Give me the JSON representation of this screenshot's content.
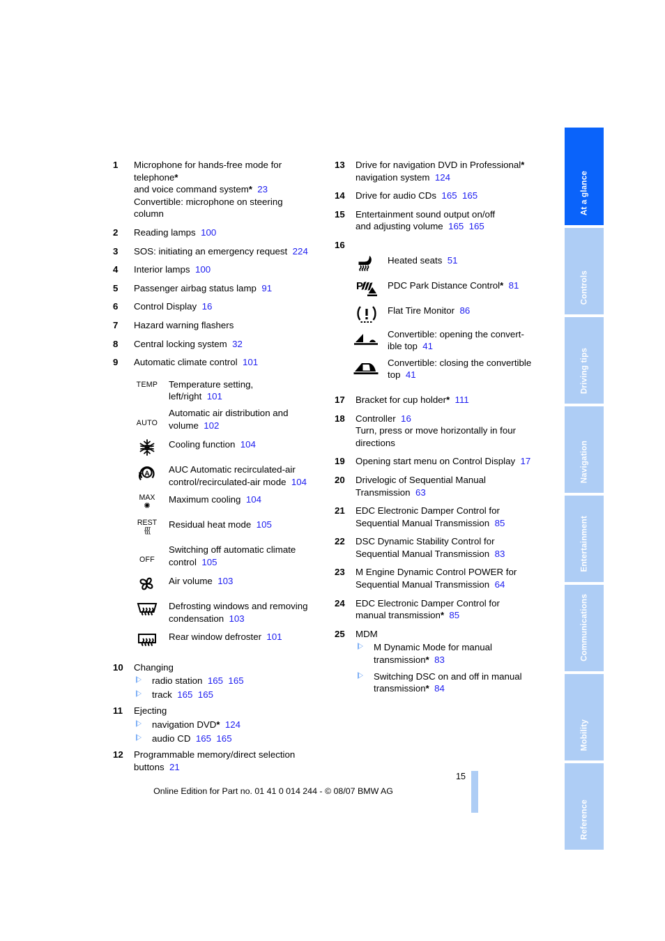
{
  "page": {
    "number": "15",
    "footer": "Online Edition for Part no. 01 41 0 014 244 - © 08/07 BMW AG",
    "link_color": "#1c1cf0",
    "tab_active_color": "#0a63fa",
    "tab_inactive_color": "#aecdf5"
  },
  "tabs": [
    {
      "label": "At a glance",
      "active": true
    },
    {
      "label": "Controls",
      "active": false
    },
    {
      "label": "Driving tips",
      "active": false
    },
    {
      "label": "Navigation",
      "active": false
    },
    {
      "label": "Entertainment",
      "active": false
    },
    {
      "label": "Communications",
      "active": false
    },
    {
      "label": "Mobility",
      "active": false
    },
    {
      "label": "Reference",
      "active": false
    }
  ],
  "left_column": {
    "items": {
      "i1": {
        "num": "1",
        "line1": "Microphone for hands-free mode for",
        "line2": "telephone",
        "line3": "and voice command system",
        "page3": "23",
        "line4": "Convertible: microphone on steering",
        "line5": "column"
      },
      "i2": {
        "num": "2",
        "text": "Reading lamps",
        "page": "100"
      },
      "i3": {
        "num": "3",
        "text": "SOS: initiating an emergency request",
        "page": "224"
      },
      "i4": {
        "num": "4",
        "text": "Interior lamps",
        "page": "100"
      },
      "i5": {
        "num": "5",
        "text": "Passenger airbag status lamp",
        "page": "91"
      },
      "i6": {
        "num": "6",
        "text": "Control Display",
        "page": "16"
      },
      "i7": {
        "num": "7",
        "text": "Hazard warning flashers",
        "page": ""
      },
      "i8": {
        "num": "8",
        "text": "Central locking system",
        "page": "32"
      },
      "i9": {
        "num": "9",
        "text": "Automatic climate control",
        "page": "101"
      },
      "i10": {
        "num": "10",
        "text": "Changing"
      },
      "i11": {
        "num": "11",
        "text": "Ejecting"
      },
      "i12": {
        "num": "12",
        "line1": "Programmable memory/direct selection",
        "line2": "buttons",
        "page": "21"
      }
    },
    "climate_icons": [
      {
        "icon": "TEMP",
        "icon_name": "temp-label-icon",
        "line1": "Temperature setting,",
        "line2": "left/right",
        "page": "101"
      },
      {
        "icon": "AUTO",
        "icon_name": "auto-label-icon",
        "line1": "Automatic air distribution and",
        "line2": "volume",
        "page": "102"
      },
      {
        "icon": "snowflake",
        "icon_name": "snowflake-icon",
        "line1": "Cooling function",
        "line2": "",
        "page": "104"
      },
      {
        "icon": "auc",
        "icon_name": "auc-recirculation-icon",
        "line1": "AUC Automatic recirculated-air",
        "line2": "control/recirculated-air mode",
        "page": "104"
      },
      {
        "icon": "MAX",
        "icon_name": "max-cooling-icon",
        "line1": "Maximum cooling",
        "line2": "",
        "page": "104"
      },
      {
        "icon": "REST",
        "icon_name": "residual-heat-icon",
        "line1": "Residual heat mode",
        "line2": "",
        "page": "105"
      },
      {
        "icon": "OFF",
        "icon_name": "off-label-icon",
        "line1": "Switching off automatic climate",
        "line2": "control",
        "page": "105"
      },
      {
        "icon": "fan",
        "icon_name": "fan-icon",
        "line1": "Air volume",
        "line2": "",
        "page": "103"
      },
      {
        "icon": "defrost-front",
        "icon_name": "windshield-defrost-icon",
        "line1": "Defrosting windows and removing",
        "line2": "condensation",
        "page": "103"
      },
      {
        "icon": "defrost-rear",
        "icon_name": "rear-window-defrost-icon",
        "line1": "Rear window defroster",
        "line2": "",
        "page": "101"
      }
    ],
    "changing_subs": [
      {
        "text": "radio station",
        "page1": "165",
        "page2": "165"
      },
      {
        "text": "track",
        "page1": "165",
        "page2": "165"
      }
    ],
    "ejecting_subs": [
      {
        "text": "navigation DVD",
        "star": true,
        "page1": "124",
        "page2": ""
      },
      {
        "text": "audio CD",
        "star": false,
        "page1": "165",
        "page2": "165"
      }
    ]
  },
  "right_column": {
    "items": {
      "i13": {
        "num": "13",
        "line1": "Drive for navigation DVD in Professional",
        "line2": "navigation system",
        "page": "124"
      },
      "i14": {
        "num": "14",
        "text": "Drive for audio CDs",
        "page1": "165",
        "page2": "165"
      },
      "i15": {
        "num": "15",
        "line1": "Entertainment sound output on/off",
        "line2": "and adjusting volume",
        "page1": "165",
        "page2": "165"
      },
      "i16": {
        "num": "16"
      },
      "i17": {
        "num": "17",
        "text": "Bracket for cup holder",
        "star": true,
        "page": "111"
      },
      "i18": {
        "num": "18",
        "text": "Controller",
        "page": "16",
        "line2": "Turn, press or move horizontally in four",
        "line3": "directions"
      },
      "i19": {
        "num": "19",
        "text": "Opening start menu on Control Display",
        "page": "17"
      },
      "i20": {
        "num": "20",
        "line1": "Drivelogic of Sequential Manual",
        "line2": "Transmission",
        "page": "63"
      },
      "i21": {
        "num": "21",
        "line1": "EDC Electronic Damper Control for",
        "line2": "Sequential Manual Transmission",
        "page": "85"
      },
      "i22": {
        "num": "22",
        "line1": "DSC Dynamic Stability Control for",
        "line2": "Sequential Manual Transmission",
        "page": "83"
      },
      "i23": {
        "num": "23",
        "line1": "M Engine Dynamic Control POWER for",
        "line2": "Sequential Manual Transmission",
        "page": "64"
      },
      "i24": {
        "num": "24",
        "line1": "EDC Electronic Damper Control for",
        "line2": "manual transmission",
        "star": true,
        "page": "85"
      },
      "i25": {
        "num": "25",
        "text": "MDM"
      }
    },
    "item16_icons": [
      {
        "icon": "heated-seat",
        "icon_name": "heated-seat-icon",
        "line1": "Heated seats",
        "line2": "",
        "page": "51"
      },
      {
        "icon": "pdc",
        "icon_name": "pdc-park-distance-icon",
        "line1": "PDC Park Distance Control",
        "star": true,
        "line2": "",
        "page": "81"
      },
      {
        "icon": "flat-tire",
        "icon_name": "flat-tire-monitor-icon",
        "line1": "Flat Tire Monitor",
        "line2": "",
        "page": "86"
      },
      {
        "icon": "top-open",
        "icon_name": "convertible-top-open-icon",
        "line1": "Convertible: opening the convert-",
        "line2": "ible top",
        "page": "41"
      },
      {
        "icon": "top-close",
        "icon_name": "convertible-top-close-icon",
        "line1": "Convertible: closing the convertible",
        "line2": "top",
        "page": "41"
      }
    ],
    "mdm_subs": [
      {
        "line1": "M Dynamic Mode for manual",
        "line2": "transmission",
        "star": true,
        "page": "83"
      },
      {
        "line1": "Switching DSC on and off in manual",
        "line2": "transmission",
        "star": true,
        "page": "84"
      }
    ]
  }
}
